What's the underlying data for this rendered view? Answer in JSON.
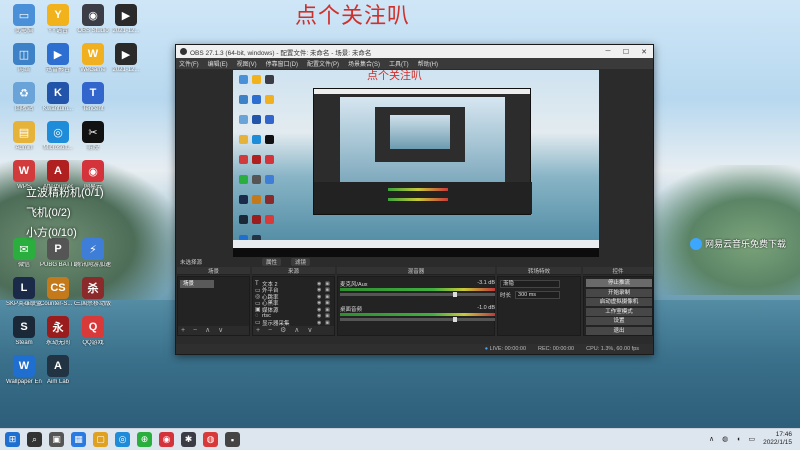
{
  "overlay_title": "点个关注叭",
  "desktop_icons": [
    {
      "label": "此电脑",
      "color": "#4a90d9",
      "glyph": "▭"
    },
    {
      "label": "YY语音",
      "color": "#f2b21c",
      "glyph": "Y"
    },
    {
      "label": "OBS Studio",
      "color": "#3c3c46",
      "glyph": "◉"
    },
    {
      "label": "2021-12...",
      "color": "#2a2a2a",
      "glyph": "▶"
    },
    {
      "label": "网络",
      "color": "#3d82c6",
      "glyph": "◫"
    },
    {
      "label": "迅雷影音",
      "color": "#2d6fd1",
      "glyph": "▶"
    },
    {
      "label": "WeGame",
      "color": "#f0b020",
      "glyph": "W"
    },
    {
      "label": "2021-12...",
      "color": "#2a2a2a",
      "glyph": "▶"
    },
    {
      "label": "回收站",
      "color": "#6aa3d8",
      "glyph": "♻"
    },
    {
      "label": "Kwantum...",
      "color": "#2255aa",
      "glyph": "K"
    },
    {
      "label": "Tencent",
      "color": "#3366cc",
      "glyph": "T"
    },
    {
      "label": "Admin",
      "color": "#e6b33a",
      "glyph": "▤"
    },
    {
      "label": "Microsoft...",
      "color": "#1e8cd8",
      "glyph": "◎"
    },
    {
      "label": "剪映",
      "color": "#111111",
      "glyph": "✂"
    },
    {
      "label": "WPS",
      "color": "#d23b3b",
      "glyph": "W"
    },
    {
      "label": "Afterburner",
      "color": "#b02020",
      "glyph": "A"
    },
    {
      "label": "网易云",
      "color": "#d4333c",
      "glyph": "◉"
    },
    {
      "label": "微信",
      "color": "#2aae3d",
      "glyph": "✉"
    },
    {
      "label": "PUBG BATTLEGR...",
      "color": "#555555",
      "glyph": "P"
    },
    {
      "label": "腾讯网游加速器",
      "color": "#3e7ed8",
      "glyph": "⚡"
    },
    {
      "label": "SKP英雄联盟",
      "color": "#1c2a4a",
      "glyph": "L"
    },
    {
      "label": "Counter-S... Global Off...",
      "color": "#c47a1a",
      "glyph": "CS"
    },
    {
      "label": "三国杀移动版",
      "color": "#8a2a2a",
      "glyph": "杀"
    },
    {
      "label": "Steam",
      "color": "#1b2838",
      "glyph": "S"
    },
    {
      "label": "永劫无间",
      "color": "#9a1c1c",
      "glyph": "永"
    },
    {
      "label": "QQ游戏",
      "color": "#d83a3a",
      "glyph": "Q"
    },
    {
      "label": "Wallpaper Engine:...",
      "color": "#1f6fd0",
      "glyph": "W"
    },
    {
      "label": "Aim Lab",
      "color": "#223344",
      "glyph": "A"
    }
  ],
  "overlay_labels": [
    "立波精粉机(0/1)",
    "飞机(0/2)",
    "小方(0/10)"
  ],
  "float_badge": "网易云音乐免费下载",
  "obs": {
    "title": "OBS 27.1.3 (64-bit, windows) - 配置文件: 未命名 - 场景: 未命名",
    "menu": [
      "文件(F)",
      "编辑(E)",
      "视图(V)",
      "停靠窗口(D)",
      "配置文件(P)",
      "场景集合(S)",
      "工具(T)",
      "帮助(H)"
    ],
    "preview_overlay": "点个关注叭",
    "scene_bar": {
      "left": "未选择源",
      "props": "属性",
      "filters": "滤镜"
    },
    "dock_headers": {
      "scenes": "场景",
      "sources": "来源",
      "mixer": "混音器",
      "transitions": "转场特效",
      "controls": "控件"
    },
    "scene_item": "场景",
    "sources": [
      {
        "icon": "T",
        "name": "文本 2"
      },
      {
        "icon": "▭",
        "name": "外平台"
      },
      {
        "icon": "◎",
        "name": "心跳率"
      },
      {
        "icon": "▭",
        "name": "心黑率"
      },
      {
        "icon": "▣",
        "name": "媒体源"
      },
      {
        "icon": "◌",
        "name": "rtsc"
      },
      {
        "icon": "▭",
        "name": "显示器采集"
      }
    ],
    "mixer": [
      {
        "name": "麦克风/Aux",
        "db": "-3.1 dB",
        "level": 0.7
      },
      {
        "name": "桌面音频",
        "db": "-1.0 dB",
        "level": 0.72
      }
    ],
    "transition": {
      "selected": "渐隐",
      "duration_label": "时长",
      "duration": "300 ms"
    },
    "controls": [
      "停止推流",
      "开始录制",
      "启动虚拟摄像机",
      "工作室模式",
      "设置",
      "退出"
    ],
    "status": {
      "live": "LIVE: 00:00:00",
      "rec": "REC: 00:00:00",
      "cpu": "CPU: 1.3%, 60.00 fps"
    }
  },
  "taskbar": {
    "clock_time": "17:46",
    "clock_date": "2022/1/15",
    "apps": [
      "⊞",
      "⌕",
      "▣",
      "▦",
      "▢",
      "◎",
      "⊕",
      "◉",
      "✱",
      "◍",
      "▪"
    ]
  },
  "colors": {
    "accent": "#3da6ff",
    "overlay_red": "#d0302a"
  }
}
